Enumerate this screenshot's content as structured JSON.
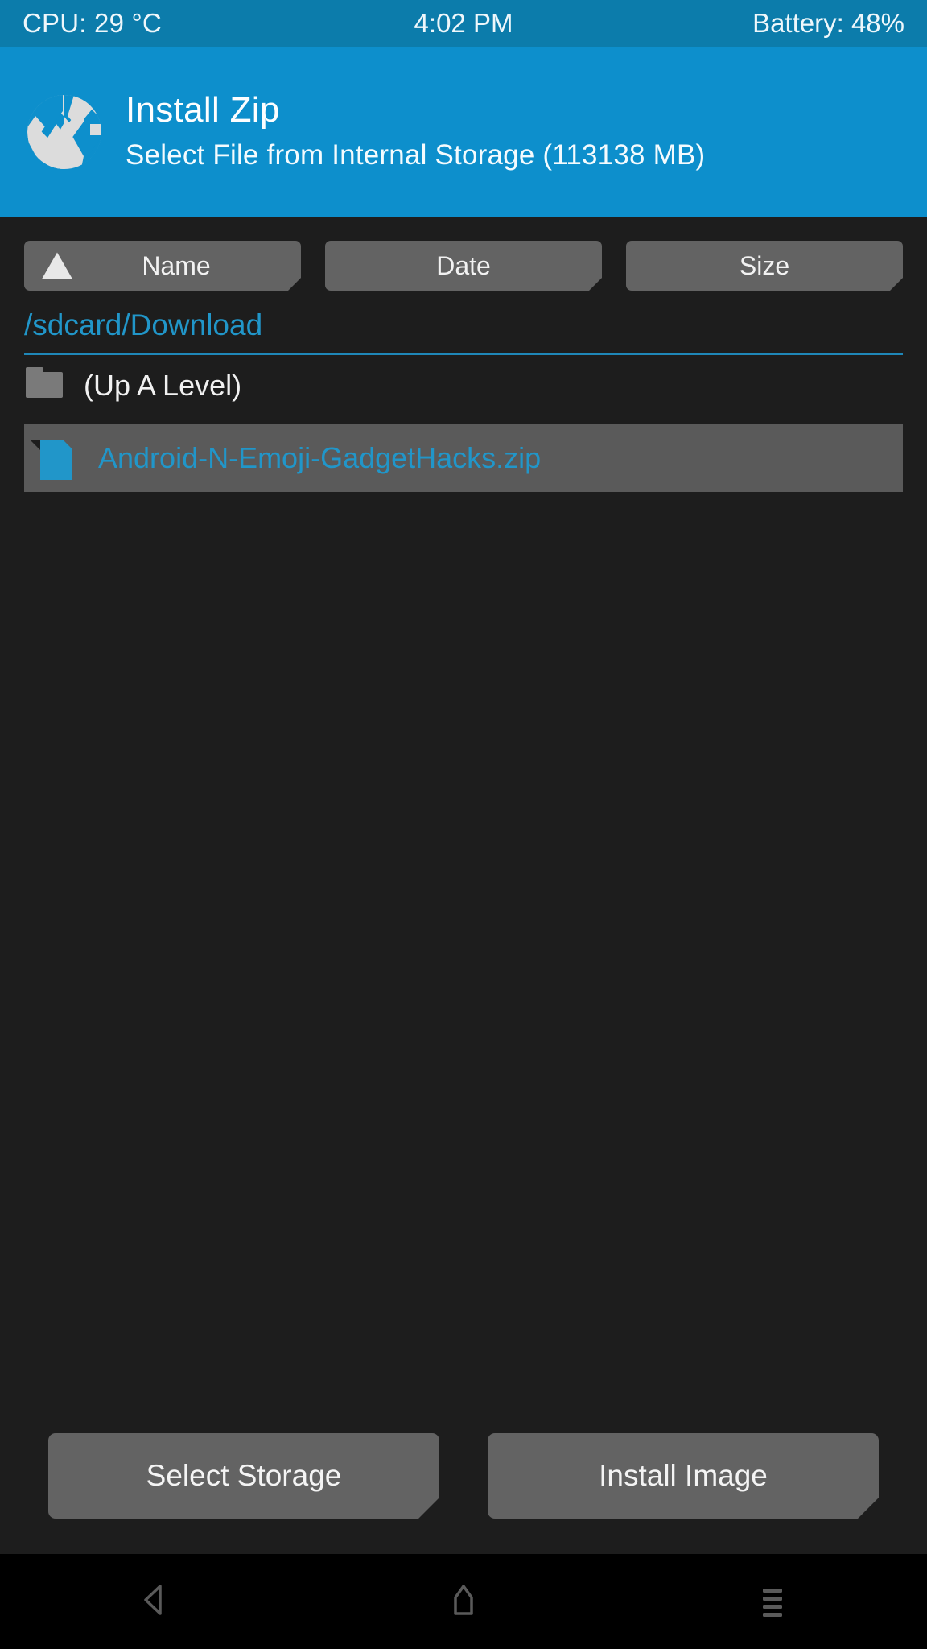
{
  "statusbar": {
    "cpu": "CPU: 29 °C",
    "time": "4:02 PM",
    "battery": "Battery: 48%"
  },
  "header": {
    "logo_icon": "twrp-logo-icon",
    "title": "Install Zip",
    "subtitle": "Select File from Internal Storage (113138 MB)",
    "accent_color": "#0d8fcc",
    "statusbar_color": "#0c7cab"
  },
  "sort": {
    "buttons": [
      {
        "label": "Name",
        "active": true,
        "indicator_icon": "sort-ascending-triangle-icon"
      },
      {
        "label": "Date",
        "active": false,
        "indicator_icon": ""
      },
      {
        "label": "Size",
        "active": false,
        "indicator_icon": ""
      }
    ]
  },
  "path": {
    "current": "/sdcard/Download",
    "color": "#2196c9"
  },
  "files": [
    {
      "name": "(Up A Level)",
      "icon": "folder-icon",
      "type": "folder",
      "selected": false,
      "text_color": "#f1f1f1"
    },
    {
      "name": "Android-N-Emoji-GadgetHacks.zip",
      "icon": "file-zip-icon",
      "type": "file",
      "selected": true,
      "text_color": "#2196c9"
    }
  ],
  "actions": [
    {
      "label": "Select Storage"
    },
    {
      "label": "Install Image"
    }
  ],
  "navbar": {
    "back_icon": "back-triangle-icon",
    "home_icon": "home-icon",
    "menu_icon": "menu-lines-icon"
  }
}
